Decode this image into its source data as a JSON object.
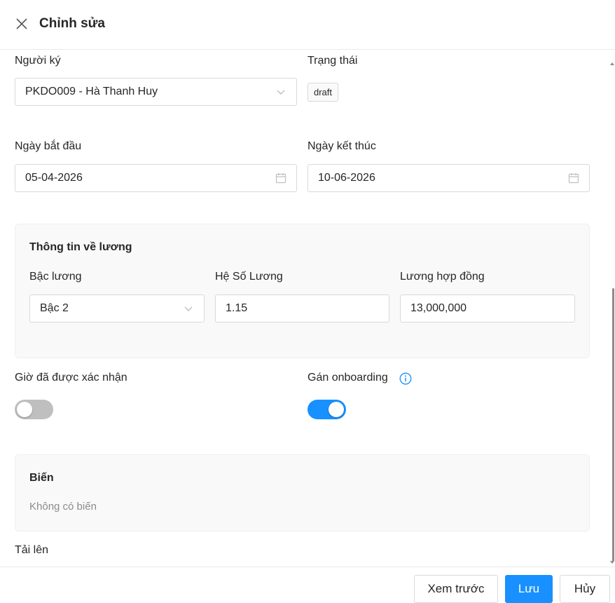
{
  "header": {
    "title": "Chỉnh sửa"
  },
  "form": {
    "signer": {
      "label": "Người ký",
      "value": "PKDO009 - Hà Thanh Huy"
    },
    "status": {
      "label": "Trạng thái",
      "value": "draft"
    },
    "start_date": {
      "label": "Ngày bắt đầu",
      "value": "05-04-2026"
    },
    "end_date": {
      "label": "Ngày kết thúc",
      "value": "10-06-2026"
    },
    "salary": {
      "title": "Thông tin về lương",
      "grade": {
        "label": "Bậc lương",
        "value": "Bậc 2"
      },
      "coefficient": {
        "label": "Hệ Số Lương",
        "value": "1.15"
      },
      "contract_salary": {
        "label": "Lương hợp đồng",
        "value": "13,000,000"
      }
    },
    "hours_confirmed": {
      "label": "Giờ đã được xác nhận",
      "checked": false
    },
    "assign_onboarding": {
      "label": "Gán onboarding",
      "checked": true
    },
    "variables": {
      "title": "Biến",
      "empty_text": "Không có biến"
    },
    "upload": {
      "label": "Tải lên"
    }
  },
  "footer": {
    "preview_label": "Xem trước",
    "save_label": "Lưu",
    "cancel_label": "Hủy"
  },
  "colors": {
    "primary": "#1890ff",
    "toggle_off": "#bfbfbf",
    "section_bg": "#f9f9f9"
  },
  "icons": [
    "close-icon",
    "chevron-down-icon",
    "calendar-icon",
    "info-icon"
  ]
}
